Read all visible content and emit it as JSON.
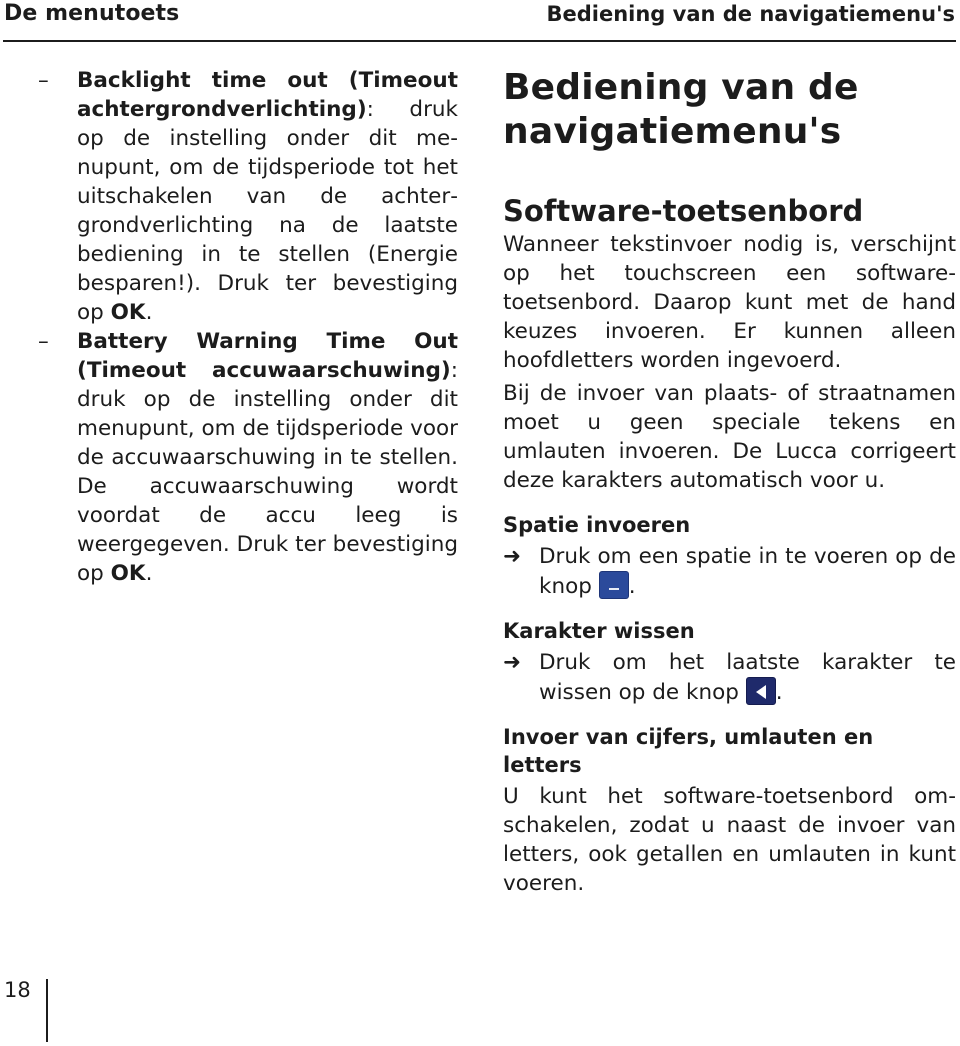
{
  "header": {
    "left_title": "De menutoets",
    "right_title": "Bediening van de navigatiemenu's"
  },
  "left_column": {
    "items": [
      {
        "bullet": "–",
        "term": "Backlight time out (Timeout achtergrondverlichting)",
        "colon": ":",
        "text": " druk op de instelling onder dit me­nupunt, om de tijdsperiode tot het uitschakelen van de achter­grondverlichting na de laatste bediening in te stellen (Energie besparen!). Druk ter bevestiging op ",
        "key": "OK",
        "end": "."
      },
      {
        "bullet": "–",
        "term": "Battery Warning Time Out (Timeout accuwaarschuwing)",
        "colon": ":",
        "text": " druk op de instelling onder dit menupunt, om de tijdsperiode voor de accuwaarschuwing in te stellen. De accuwaarschu­wing wordt voordat de accu leeg is weergegeven. Druk ter bevestiging op ",
        "key": "OK",
        "end": "."
      }
    ]
  },
  "right_column": {
    "title": "Bediening van de navigatiemenu's",
    "section_title": "Software-toetsenbord",
    "paragraphs": [
      "Wanneer tekstinvoer nodig is, ver­schijnt op het touchscreen een soft­ware-toetsenbord. Daarop kunt met de hand keuzes invoeren. Er kunnen alleen hoofdletters worden ingevoerd.",
      "Bij de invoer van plaats- of straat­namen moet u geen speciale tekens en umlauten invoeren. De Lucca cor­rigeert deze karakters automatisch voor u."
    ],
    "space": {
      "heading": "Spatie invoeren",
      "arrow": "➜",
      "text": "Druk om een spatie in te voeren op de knop ",
      "icon": "space-key-icon",
      "end": "."
    },
    "delete": {
      "heading": "Karakter wissen",
      "arrow": "➜",
      "text": "Druk om het laatste karakter te wissen op de knop ",
      "icon": "backspace-key-icon",
      "end": "."
    },
    "numbers": {
      "heading": "Invoer van cijfers, umlauten en letters",
      "text": "U kunt het software-toetsenbord om­schakelen, zodat u naast de invoer van letters, ook getallen en umlauten in kunt voeren."
    }
  },
  "footer": {
    "page_number": "18"
  },
  "colors": {
    "text": "#1c1c1c",
    "space_key": "#2b4a9b",
    "backspace_key": "#1f2a6b"
  }
}
